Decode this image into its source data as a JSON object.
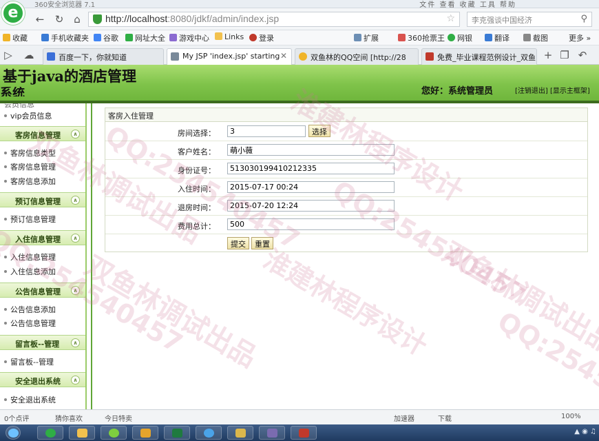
{
  "browser": {
    "window_title": "360安全浏览器 7.1",
    "menu_text": "文件 查看 收藏 工具 帮助",
    "url_host": "http://localhost",
    "url_path": ":8080/jdkf/admin/index.jsp",
    "search_placeholder": "李克强谈中国经济",
    "bookmarks": [
      "收藏",
      "手机收藏夹",
      "谷歌",
      "网址大全",
      "游戏中心",
      "Links",
      "登录"
    ],
    "bookmarks_right": [
      "扩展",
      "360抢票王",
      "网银",
      "翻译",
      "截图",
      "更多 »"
    ],
    "tabs": [
      {
        "label": "百度一下，你就知道"
      },
      {
        "label": "My JSP 'index.jsp' starting"
      },
      {
        "label": "双鱼林的QQ空间 [http://28"
      },
      {
        "label": "免费_毕业课程范例设计_双鱼"
      }
    ]
  },
  "header": {
    "title_line1": "基于java的酒店管理",
    "title_line2": "系统",
    "greeting": "您好：系统管理员",
    "links": "[注销退出] [显示主框架]"
  },
  "sidebar": {
    "top_partial": "会员信息",
    "top_item": "vip会员信息",
    "sections": [
      {
        "title": "客房信息管理",
        "items": [
          "客房信息类型",
          "客房信息管理",
          "客房信息添加"
        ]
      },
      {
        "title": "预订信息管理",
        "items": [
          "预订信息管理"
        ]
      },
      {
        "title": "入住信息管理",
        "items": [
          "入住信息管理",
          "入住信息添加"
        ]
      },
      {
        "title": "公告信息管理",
        "items": [
          "公告信息添加",
          "公告信息管理"
        ]
      },
      {
        "title": "留言板--管理",
        "items": [
          "留言板--管理"
        ]
      },
      {
        "title": "安全退出系统",
        "items": [
          "安全退出系统"
        ]
      }
    ]
  },
  "form": {
    "panel_title": "客房入住管理",
    "fields": [
      {
        "label": "房间选择：",
        "value": "3"
      },
      {
        "label": "客户姓名：",
        "value": "萌小薇"
      },
      {
        "label": "身份证号：",
        "value": "513030199410212335"
      },
      {
        "label": "入住时间：",
        "value": "2015-07-17 00:24"
      },
      {
        "label": "退房时间：",
        "value": "2015-07-20 12:24"
      },
      {
        "label": "费用总计：",
        "value": "500"
      }
    ],
    "select_button": "选择",
    "submit_button": "提交",
    "reset_button": "重置"
  },
  "statusbar": {
    "left": [
      "0个点评",
      "猜你喜欢",
      "今日特卖"
    ],
    "accelerator": "加速器",
    "download": "下载",
    "zoom": "100%"
  },
  "watermark": [
    "双鱼林调试出品",
    "QQ:254540457",
    "淮建林程序设计"
  ],
  "colors": {
    "header_green": "#7fc34a",
    "accent_dark": "#3c6b1e",
    "section_bg": "#d6ecb0"
  }
}
